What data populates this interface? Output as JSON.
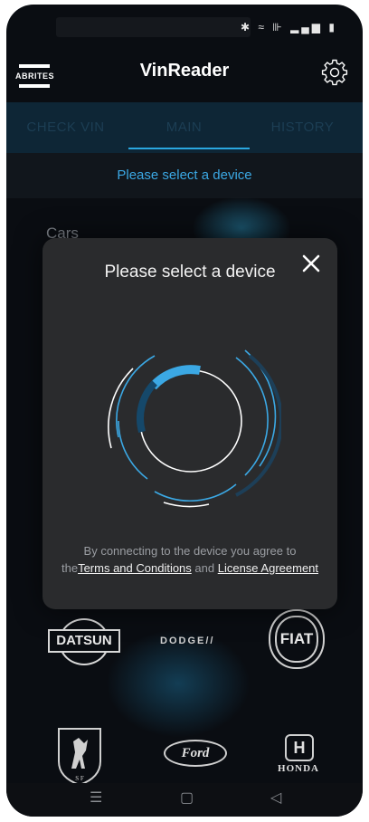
{
  "status_bar": {
    "icons": [
      "bluetooth-icon",
      "wifi-icon",
      "volte-icon",
      "signal-icon",
      "battery-icon"
    ]
  },
  "app": {
    "logo_text": "ABRITES",
    "title": "VinReader"
  },
  "tabs": [
    {
      "label": "CHECK VIN"
    },
    {
      "label": "MAIN",
      "active": true
    },
    {
      "label": "HISTORY"
    }
  ],
  "subheader": "Please select a device",
  "section_label": "Cars",
  "brands": {
    "datsun": "DATSUN",
    "dodge": "DODGE",
    "fiat": "FIAT",
    "ford": "Ford",
    "honda": "HONDA",
    "ferrari": "Ferrari"
  },
  "dialog": {
    "title": "Please select a device",
    "terms_prefix": "By connecting to the device you agree to the",
    "terms_link": "Terms and Conditions",
    "terms_and": " and ",
    "license_link": "License Agreement"
  },
  "colors": {
    "accent": "#3ba8e4",
    "background": "#0a0d12",
    "dialog": "#2a2b2d",
    "tabs_bg": "#0e2636"
  }
}
